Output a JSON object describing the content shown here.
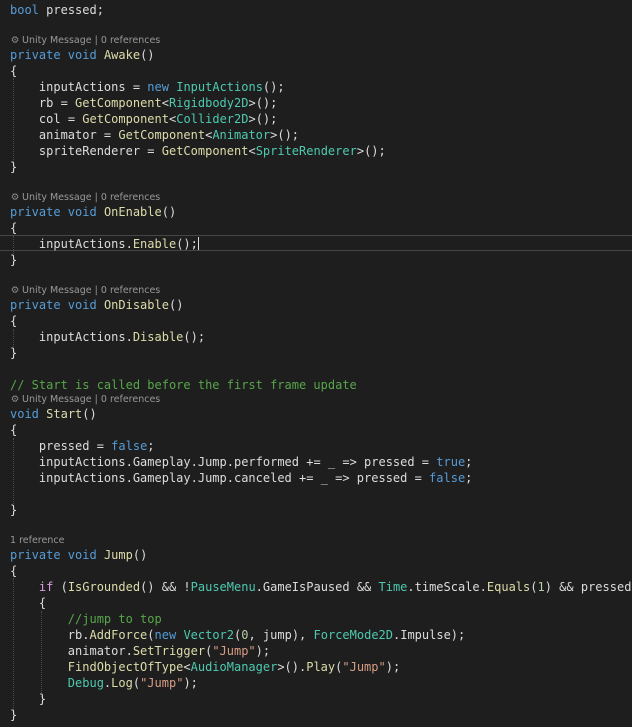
{
  "editor": {
    "code_lens": {
      "unity_message": "Unity Message",
      "separator": " | ",
      "zero_references": "0 references",
      "one_reference": "1 reference"
    },
    "field_line": {
      "keyword": "bool",
      "name": "pressed;"
    },
    "awake": {
      "modifiers": "private void",
      "name": "Awake",
      "statements": [
        {
          "target": "inputActions",
          "op": " = ",
          "keyword": "new",
          "type": "InputActions",
          "tail": "();"
        },
        {
          "target": "rb",
          "op": " = ",
          "method": "GetComponent",
          "type": "Rigidbody2D",
          "tail": "();"
        },
        {
          "target": "col",
          "op": " = ",
          "method": "GetComponent",
          "type": "Collider2D",
          "tail": "();"
        },
        {
          "target": "animator",
          "op": " = ",
          "method": "GetComponent",
          "type": "Animator",
          "tail": "();"
        },
        {
          "target": "spriteRenderer",
          "op": " = ",
          "method": "GetComponent",
          "type": "SpriteRenderer",
          "tail": "();"
        }
      ]
    },
    "on_enable": {
      "modifiers": "private void",
      "name": "OnEnable",
      "object": "inputActions.",
      "method": "Enable",
      "tail": "();"
    },
    "on_disable": {
      "modifiers": "private void",
      "name": "OnDisable",
      "object": "inputActions.",
      "method": "Disable",
      "tail": "();"
    },
    "start": {
      "comment": "// Start is called before the first frame update",
      "modifiers": "void",
      "name": "Start",
      "assign_target": "pressed",
      "assign_op": " = ",
      "assign_value": "false",
      "performed_head": "inputActions.Gameplay.Jump.performed += _ => pressed = ",
      "performed_value": "true",
      "canceled_head": "inputActions.Gameplay.Jump.canceled += _ => pressed = ",
      "canceled_value": "false"
    },
    "jump": {
      "modifiers": "private void",
      "name": "Jump",
      "if_keyword": "if",
      "cond_call": "IsGrounded",
      "cond_part_a": "() && !",
      "pause_type": "PauseMenu",
      "cond_part_b": ".GameIsPaused && ",
      "time_type": "Time",
      "cond_part_c": ".timeScale.",
      "equals_method": "Equals",
      "equals_arg": "1",
      "cond_part_d": ") && pressed)",
      "comment": "//jump to top",
      "add_force_object": "rb.",
      "add_force_method": "AddForce",
      "new_keyword": "new",
      "vector_type": "Vector2",
      "vector_args_a": "0",
      "vector_args_b": ", jump), ",
      "force_mode_type": "ForceMode2D",
      "force_mode_tail": ".Impulse);",
      "trigger_object": "animator.",
      "trigger_method": "SetTrigger",
      "trigger_arg": "\"Jump\"",
      "find_method": "FindObjectOfType",
      "audio_type": "AudioManager",
      "play_method": "Play",
      "play_arg": "\"Jump\"",
      "debug_type": "Debug",
      "log_method": "Log",
      "log_arg": "\"Jump\""
    }
  }
}
